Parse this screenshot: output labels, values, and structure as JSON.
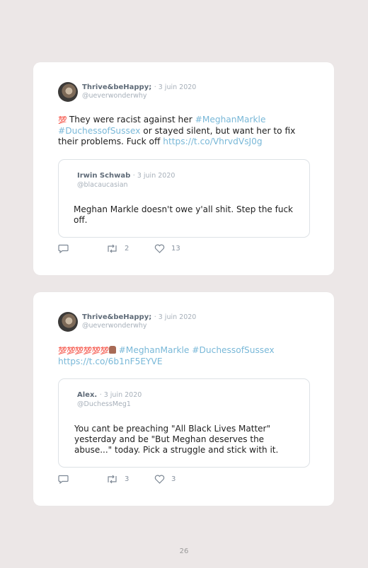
{
  "tweets": [
    {
      "author": "Thrive&beHappy;",
      "date": "· 3 juin 2020",
      "handle": "@ueverwonderwhy",
      "emoji": "💯",
      "text_plain": " They were racist against her ",
      "tag1": "#MeghanMarkle",
      "tag2": "#DuchessofSussex",
      "text_tail": " or stayed silent, but want her to fix their problems. Fuck off ",
      "link": "https://t.co/VhrvdVsJ0g",
      "quote": {
        "author": "Irwin Schwab",
        "date": "· 3 juin 2020",
        "handle": "@blacaucasian",
        "text": "Meghan Markle doesn't owe y'all shit. Step the fuck off."
      },
      "retweets": "2",
      "likes": "13"
    },
    {
      "author": "Thrive&beHappy;",
      "date": "· 3 juin 2020",
      "handle": "@ueverwonderwhy",
      "emoji": "💯💯💯💯💯💯",
      "tag1": "#MeghanMarkle",
      "tag2": "#DuchessofSussex",
      "link": "https://t.co/6b1nF5EYVE",
      "quote": {
        "author": "Alex.",
        "date": "· 3 juin 2020",
        "handle": "@DuchessMeg1",
        "text": "You cant be preaching \"All Black Lives Matter\" yesterday and be \"But Meghan deserves the abuse...\" today. Pick a struggle and stick with it."
      },
      "retweets": "3",
      "likes": "3"
    }
  ],
  "page_number": "26"
}
